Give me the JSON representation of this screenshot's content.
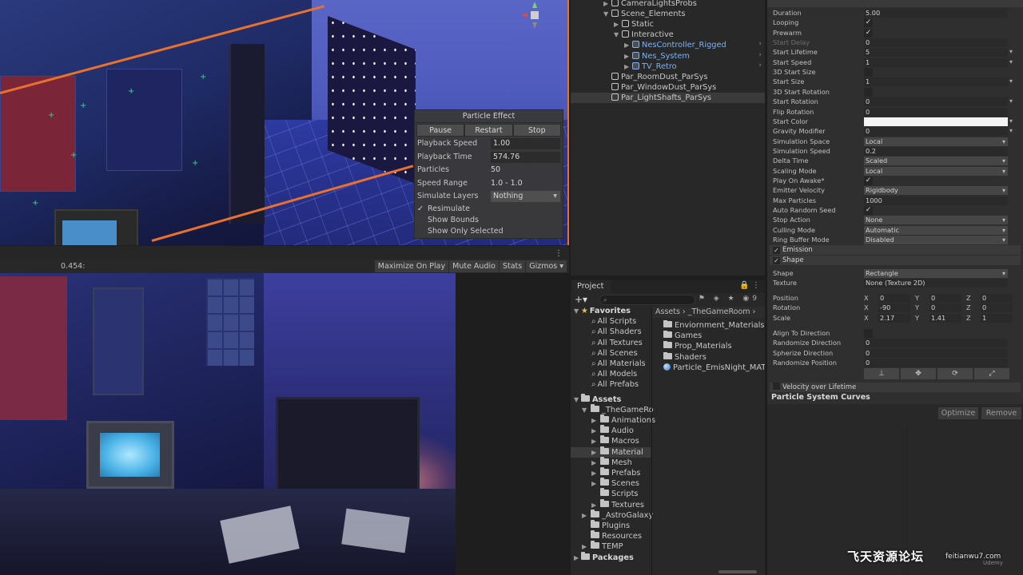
{
  "scene_view": {
    "particle_effect": {
      "title": "Particle Effect",
      "buttons": [
        "Pause",
        "Restart",
        "Stop"
      ],
      "rows": [
        {
          "label": "Playback Speed",
          "value": "1.00",
          "style": "field"
        },
        {
          "label": "Playback Time",
          "value": "574.76",
          "style": "field"
        },
        {
          "label": "Particles",
          "value": "50",
          "style": "text"
        },
        {
          "label": "Speed Range",
          "value": "1.0 - 1.0",
          "style": "text"
        },
        {
          "label": "Simulate Layers",
          "value": "Nothing",
          "style": "drop"
        }
      ],
      "checks": [
        {
          "label": "Resimulate",
          "checked": "✓"
        },
        {
          "label": "Show Bounds",
          "checked": ""
        },
        {
          "label": "Show Only Selected",
          "checked": ""
        }
      ]
    },
    "toolbar": {
      "time": "0.454:",
      "buttons": [
        "Maximize On Play",
        "Mute Audio",
        "Stats",
        "Gizmos ▾"
      ]
    }
  },
  "hierarchy": {
    "items": [
      {
        "label": "CameraLightsProbs",
        "indent": 3,
        "arrow": "▶",
        "prefab": false,
        "chevron": ""
      },
      {
        "label": "Scene_Elements",
        "indent": 3,
        "arrow": "▼",
        "prefab": false,
        "chevron": ""
      },
      {
        "label": "Static",
        "indent": 4,
        "arrow": "▶",
        "prefab": false,
        "chevron": ""
      },
      {
        "label": "Interactive",
        "indent": 4,
        "arrow": "▼",
        "prefab": false,
        "chevron": ""
      },
      {
        "label": "NesController_Rigged",
        "indent": 5,
        "arrow": "▶",
        "prefab": true,
        "chevron": "›"
      },
      {
        "label": "Nes_System",
        "indent": 5,
        "arrow": "▶",
        "prefab": true,
        "chevron": "›"
      },
      {
        "label": "TV_Retro",
        "indent": 5,
        "arrow": "▶",
        "prefab": true,
        "chevron": "›"
      },
      {
        "label": "Par_RoomDust_ParSys",
        "indent": 3,
        "arrow": "",
        "prefab": false,
        "chevron": ""
      },
      {
        "label": "Par_WindowDust_ParSys",
        "indent": 3,
        "arrow": "",
        "prefab": false,
        "chevron": ""
      },
      {
        "label": "Par_LightShafts_ParSys",
        "indent": 3,
        "arrow": "",
        "prefab": false,
        "chevron": ""
      }
    ],
    "selected_index": 9
  },
  "project": {
    "tab_label": "Project",
    "tab_icons": "🔒 ⋮",
    "toolbar_icons": "⚑ ◈ ★ ◉9",
    "favorites_label": "Favorites",
    "favorites": [
      "All Scripts",
      "All Shaders",
      "All Textures",
      "All Scenes",
      "All Materials",
      "All Models",
      "All Prefabs"
    ],
    "assets_label": "Assets",
    "assets_tree": [
      {
        "label": "_TheGameRo",
        "level": 1,
        "arrow": "▼"
      },
      {
        "label": "Animations",
        "level": 2,
        "arrow": "▶"
      },
      {
        "label": "Audio",
        "level": 2,
        "arrow": "▶"
      },
      {
        "label": "Macros",
        "level": 2,
        "arrow": "▶"
      },
      {
        "label": "Material",
        "level": 2,
        "arrow": "▶"
      },
      {
        "label": "Mesh",
        "level": 2,
        "arrow": "▶"
      },
      {
        "label": "Prefabs",
        "level": 2,
        "arrow": "▶"
      },
      {
        "label": "Scenes",
        "level": 2,
        "arrow": "▶"
      },
      {
        "label": "Scripts",
        "level": 2,
        "arrow": ""
      },
      {
        "label": "Textures",
        "level": 2,
        "arrow": "▶"
      },
      {
        "label": "_AstroGalaxy",
        "level": 1,
        "arrow": "▶"
      },
      {
        "label": "Plugins",
        "level": 1,
        "arrow": ""
      },
      {
        "label": "Resources",
        "level": 1,
        "arrow": ""
      },
      {
        "label": "TEMP",
        "level": 1,
        "arrow": "▶"
      }
    ],
    "selected_tree_index": 4,
    "packages_label": "Packages",
    "breadcrumb": "Assets › _TheGameRoom ›",
    "contents": [
      {
        "label": "Enviornment_Materials",
        "kind": "folder"
      },
      {
        "label": "Games",
        "kind": "folder"
      },
      {
        "label": "Prop_Materials",
        "kind": "folder"
      },
      {
        "label": "Shaders",
        "kind": "folder"
      },
      {
        "label": "Particle_EmisNight_MAT",
        "kind": "material"
      }
    ]
  },
  "inspector": {
    "properties": [
      {
        "label": "Duration",
        "value": "5.00",
        "type": "field",
        "dim": false
      },
      {
        "label": "Looping",
        "value": "✓",
        "type": "check",
        "dim": false
      },
      {
        "label": "Prewarm",
        "value": "✓",
        "type": "check",
        "dim": false
      },
      {
        "label": "Start Delay",
        "value": "0",
        "type": "field",
        "dim": true
      },
      {
        "label": "Start Lifetime",
        "value": "5",
        "type": "field",
        "dim": false,
        "trail": "▾"
      },
      {
        "label": "Start Speed",
        "value": "1",
        "type": "field",
        "dim": false,
        "trail": "▾"
      },
      {
        "label": "3D Start Size",
        "value": "",
        "type": "check",
        "dim": false
      },
      {
        "label": "Start Size",
        "value": "1",
        "type": "field",
        "dim": false,
        "trail": "▾"
      },
      {
        "label": "3D Start Rotation",
        "value": "",
        "type": "check",
        "dim": false
      },
      {
        "label": "Start Rotation",
        "value": "0",
        "type": "field",
        "dim": false,
        "trail": "▾"
      },
      {
        "label": "Flip Rotation",
        "value": "0",
        "type": "field",
        "dim": false
      },
      {
        "label": "Start Color",
        "value": "",
        "type": "color",
        "dim": false,
        "trail": "▾"
      },
      {
        "label": "Gravity Modifier",
        "value": "0",
        "type": "field",
        "dim": false,
        "trail": "▾"
      },
      {
        "label": "Simulation Space",
        "value": "Local",
        "type": "drop",
        "dim": false
      },
      {
        "label": "Simulation Speed",
        "value": "0.2",
        "type": "field",
        "dim": false
      },
      {
        "label": "Delta Time",
        "value": "Scaled",
        "type": "drop",
        "dim": false
      },
      {
        "label": "Scaling Mode",
        "value": "Local",
        "type": "drop",
        "dim": false
      },
      {
        "label": "Play On Awake*",
        "value": "✓",
        "type": "check",
        "dim": false
      },
      {
        "label": "Emitter Velocity",
        "value": "Rigidbody",
        "type": "drop",
        "dim": false
      },
      {
        "label": "Max Particles",
        "value": "1000",
        "type": "field",
        "dim": false
      },
      {
        "label": "Auto Random Seed",
        "value": "✓",
        "type": "check",
        "dim": false
      },
      {
        "label": "Stop Action",
        "value": "None",
        "type": "drop",
        "dim": false
      },
      {
        "label": "Culling Mode",
        "value": "Automatic",
        "type": "drop",
        "dim": false
      },
      {
        "label": "Ring Buffer Mode",
        "value": "Disabled",
        "type": "drop",
        "dim": false
      }
    ],
    "modules": [
      {
        "label": "Emission",
        "checked": "✓"
      },
      {
        "label": "Shape",
        "checked": "✓"
      }
    ],
    "shape_props": [
      {
        "label": "Shape",
        "value": "Rectangle",
        "type": "drop"
      },
      {
        "label": "Texture",
        "value": "None (Texture 2D)",
        "type": "field"
      }
    ],
    "transform": [
      {
        "label": "Position",
        "x": "0",
        "y": "0",
        "z": "0"
      },
      {
        "label": "Rotation",
        "x": "-90",
        "y": "0",
        "z": "0"
      },
      {
        "label": "Scale",
        "x": "2.17",
        "y": "1.41",
        "z": "1"
      }
    ],
    "extra_props": [
      {
        "label": "Align To Direction",
        "value": "",
        "type": "check"
      },
      {
        "label": "Randomize Direction",
        "value": "0",
        "type": "field"
      },
      {
        "label": "Spherize Direction",
        "value": "0",
        "type": "field"
      },
      {
        "label": "Randomize Position",
        "value": "0",
        "type": "field"
      }
    ],
    "shape_tool_icons": [
      "⊥",
      "✥",
      "⟳",
      "⤢"
    ],
    "velocity_module": "Velocity over Lifetime",
    "curves_title": "Particle System Curves",
    "curve_buttons": [
      "Optimize",
      "Remove"
    ]
  },
  "watermark": {
    "text": "飞天资源论坛",
    "url": "feitianwu7.com",
    "udemy": "Udemy"
  }
}
